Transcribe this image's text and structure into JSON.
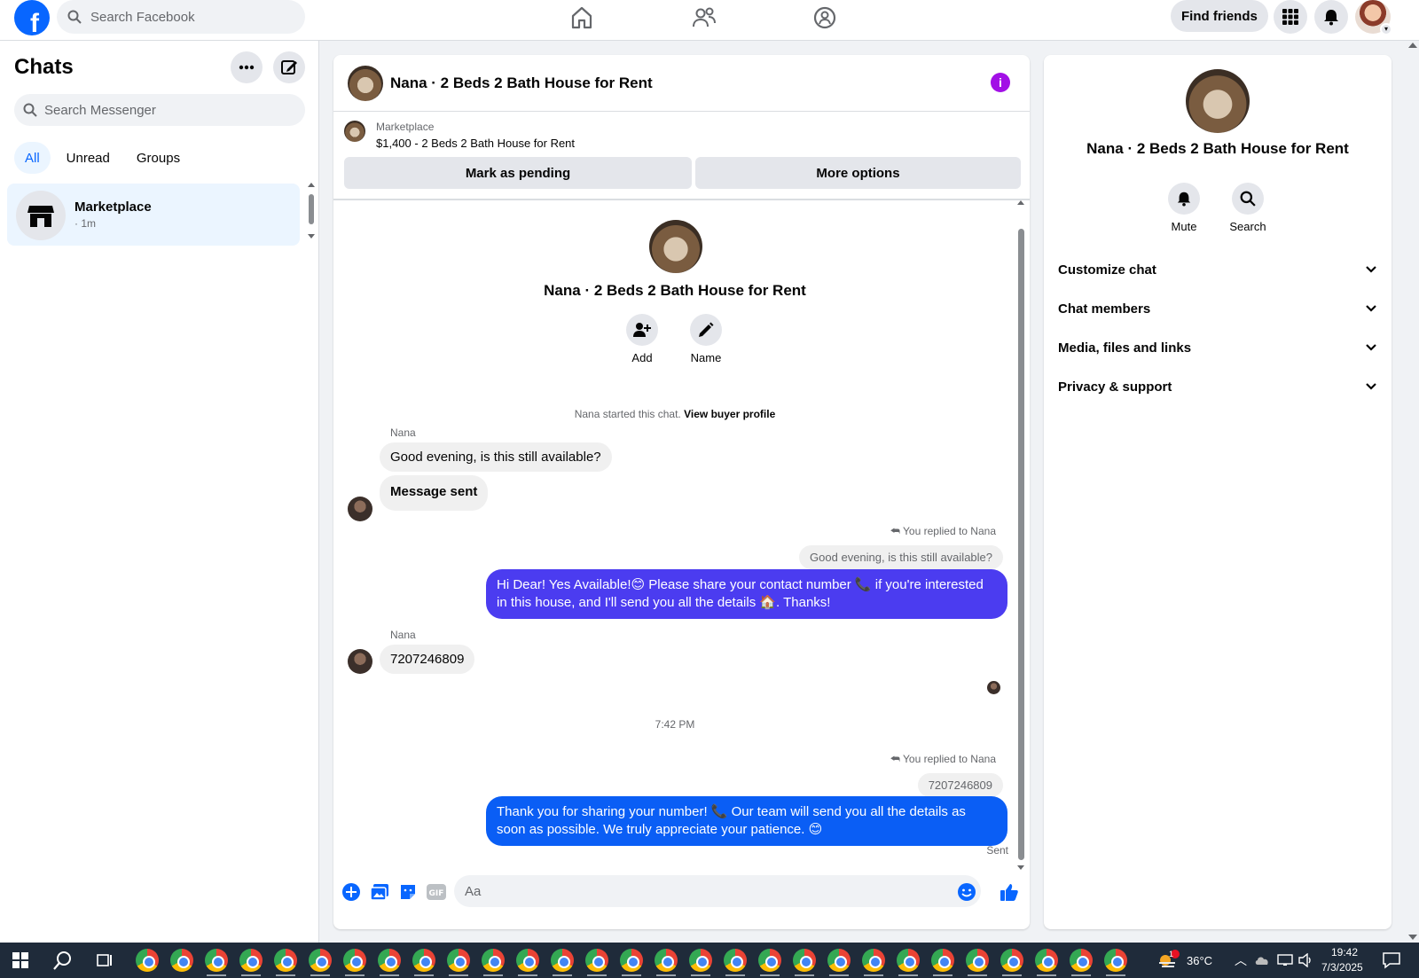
{
  "topbar": {
    "search_placeholder": "Search Facebook",
    "find_friends": "Find friends",
    "logo": "f"
  },
  "chats": {
    "title": "Chats",
    "search_placeholder": "Search Messenger",
    "filters": [
      "All",
      "Unread",
      "Groups"
    ],
    "items": [
      {
        "name": "Marketplace",
        "sub": "· 1m"
      }
    ]
  },
  "conversation": {
    "title": "Nana · 2 Beds 2 Bath House for Rent",
    "info_icon": "i",
    "marketplace_label": "Marketplace",
    "listing": "$1,400 - 2 Beds 2 Bath House for Rent",
    "mark_pending": "Mark as pending",
    "more_options": "More options",
    "intro_name": "Nana · 2 Beds 2 Bath House for Rent",
    "add_label": "Add",
    "name_label": "Name",
    "started_text": "Nana started this chat.",
    "view_buyer": "View buyer profile",
    "messages": {
      "sender1": "Nana",
      "in1": "Good evening, is this still available?",
      "in2": "Message sent",
      "reply_note1": "You replied to Nana",
      "quote1": "Good evening, is this still available?",
      "out1": "Hi Dear! Yes Available!😊 Please share your contact number 📞 if you're interested in this house, and I'll send you all the details 🏠. Thanks!",
      "sender2": "Nana",
      "in3": "7207246809",
      "time": "7:42 PM",
      "reply_note2": "You replied to Nana",
      "quote2": "7207246809",
      "out2": "Thank you for sharing your number! 📞 Our team will send you all the details as soon as possible. We truly appreciate your patience. 😊",
      "status": "Sent"
    },
    "composer_placeholder": "Aa"
  },
  "info": {
    "name": "Nana · 2 Beds 2 Bath House for Rent",
    "mute": "Mute",
    "search": "Search",
    "sections": [
      "Customize chat",
      "Chat members",
      "Media, files and links",
      "Privacy & support"
    ]
  },
  "taskbar": {
    "temp": "36°C",
    "time": "19:42",
    "date": "7/3/2025",
    "weather_badge": "1"
  },
  "colors": {
    "brand": "#0866ff",
    "bubble_out_1": "#4b3cf0",
    "bubble_out_2": "#0a5ef5",
    "info_icon": "#a210e6"
  }
}
